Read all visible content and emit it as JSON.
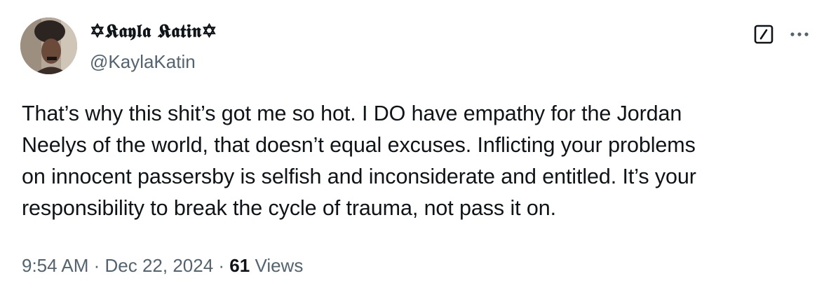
{
  "author": {
    "display_name": "✡𝕶𝖆𝖞𝖑𝖆 𝕶𝖆𝖙𝖎𝖓✡",
    "handle": "@KaylaKatin"
  },
  "tweet": {
    "lines": [
      "That’s why this shit’s got me so hot. I DO have empathy for the Jordan",
      "Neelys of the world, that doesn’t equal excuses. Inflicting your problems",
      "on innocent passersby is selfish and inconsiderate and entitled. It’s your",
      "responsibility to break the cycle of trauma, not pass it on."
    ]
  },
  "meta": {
    "time": "9:54 AM",
    "separator1": " · ",
    "date": "Dec 22, 2024",
    "separator2": " · ",
    "views_count": "61",
    "views_label": " Views"
  },
  "icons": {
    "grok": "grok-icon",
    "more": "more-icon"
  },
  "colors": {
    "text_primary": "#0f1419",
    "text_secondary": "#536471",
    "background": "#ffffff"
  }
}
